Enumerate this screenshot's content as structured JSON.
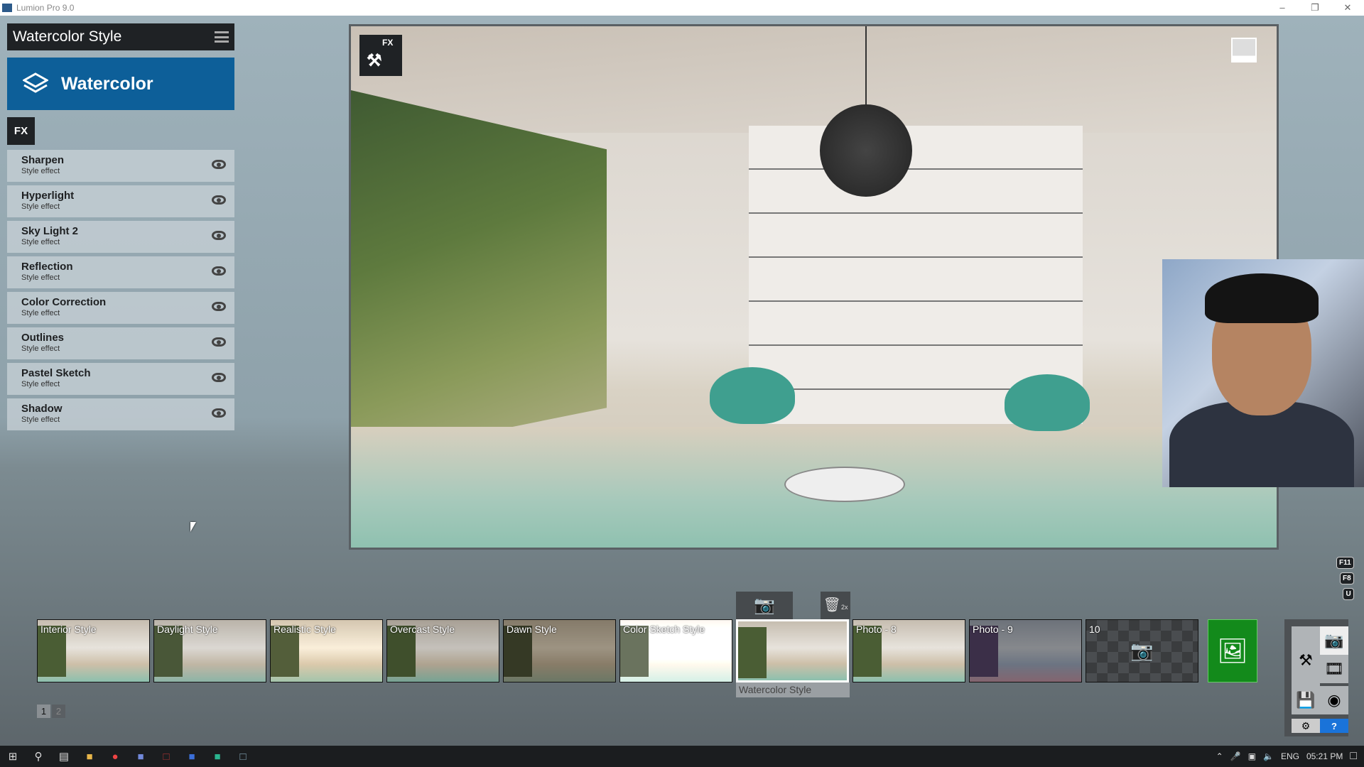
{
  "window": {
    "title": "Lumion Pro 9.0",
    "controls": [
      "minimize",
      "restore",
      "close"
    ]
  },
  "panel": {
    "header_title": "Watercolor Style",
    "banner_label": "Watercolor",
    "fx_label": "FX",
    "effects": [
      {
        "name": "Sharpen",
        "sub": "Style effect"
      },
      {
        "name": "Hyperlight",
        "sub": "Style effect"
      },
      {
        "name": "Sky Light 2",
        "sub": "Style effect"
      },
      {
        "name": "Reflection",
        "sub": "Style effect"
      },
      {
        "name": "Color Correction",
        "sub": "Style effect"
      },
      {
        "name": "Outlines",
        "sub": "Style effect"
      },
      {
        "name": "Pastel Sketch",
        "sub": "Style effect"
      },
      {
        "name": "Shadow",
        "sub": "Style effect"
      }
    ]
  },
  "viewport": {
    "fx_badge": "FX"
  },
  "hotkeys": [
    "F11",
    "F8",
    "U"
  ],
  "photos": [
    {
      "label": "Interior Style"
    },
    {
      "label": "Daylight Style"
    },
    {
      "label": "Realistic Style"
    },
    {
      "label": "Overcast Style"
    },
    {
      "label": "Dawn Style"
    },
    {
      "label": "Color Sketch Style"
    },
    {
      "label": "Watercolor Style",
      "selected": true
    },
    {
      "label": "Photo - 8"
    },
    {
      "label": "Photo - 9"
    },
    {
      "label": "10",
      "empty": true
    }
  ],
  "selected_label": "Watercolor Style",
  "trash_badge": "2x",
  "pages": [
    "1",
    "2"
  ],
  "active_page": "1",
  "colors": {
    "banner": "#0d5f99",
    "render_button": "#138a1b",
    "help": "#1a73d9"
  },
  "taskbar": {
    "language": "ENG",
    "time": "05:21 PM"
  }
}
